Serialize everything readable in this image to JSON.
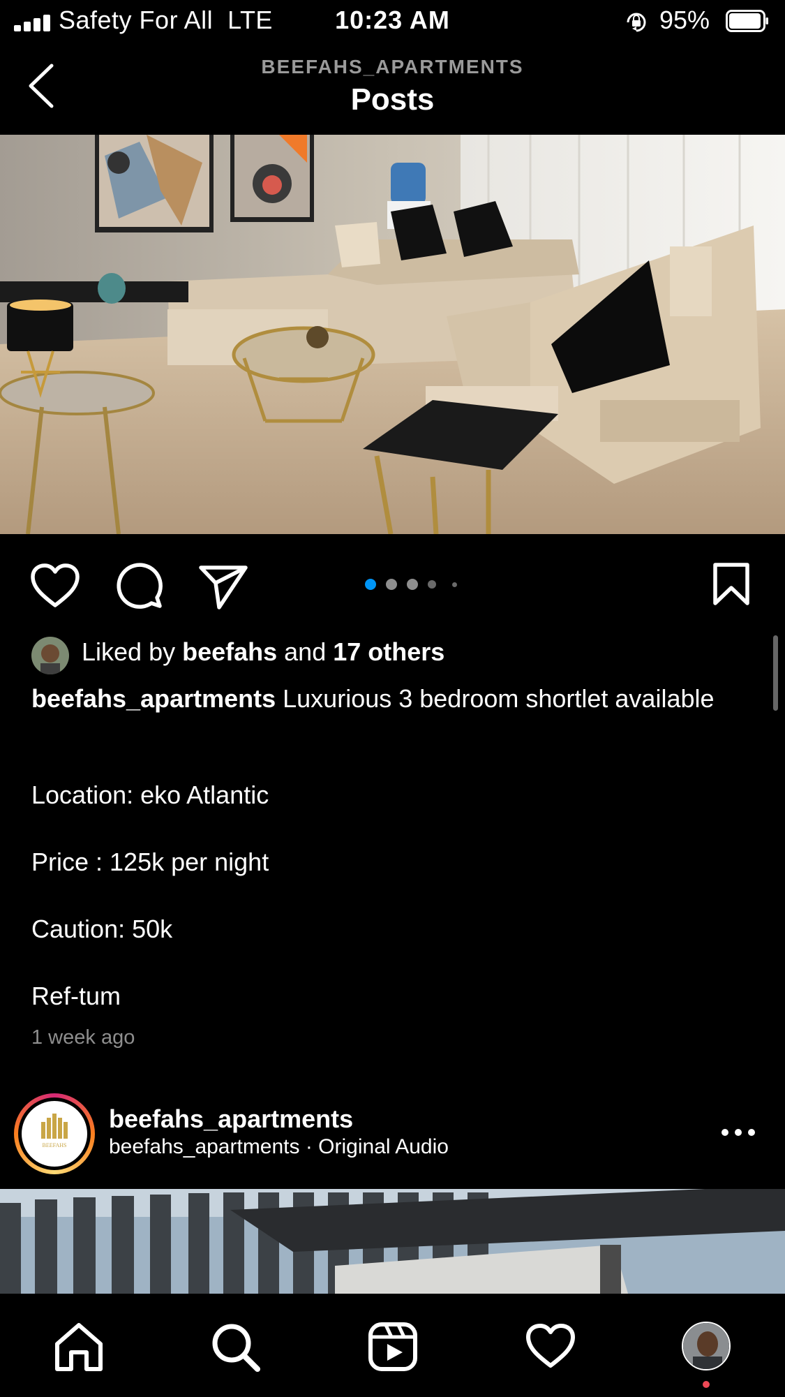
{
  "status_bar": {
    "carrier": "Safety For All  LTE",
    "time": "10:23 AM",
    "battery": "95%"
  },
  "header": {
    "account": "BEEFAHS_APARTMENTS",
    "title": "Posts"
  },
  "post": {
    "carousel_total": 5,
    "carousel_index": 1,
    "liked_by_prefix": "Liked by ",
    "liked_by_user": "beefahs",
    "liked_by_mid": " and ",
    "liked_by_others": "17 others",
    "caption_user": "beefahs_apartments",
    "caption_text": " Luxurious 3 bedroom shortlet available",
    "caption_lines": [
      "Location: eko Atlantic",
      "Price : 125k per night",
      "Caution: 50k",
      "Ref-tum"
    ],
    "time_ago": "1 week ago"
  },
  "next_post": {
    "username": "beefahs_apartments",
    "audio": "beefahs_apartments · Original Audio",
    "logo_text": "BEEFAHS"
  },
  "colors": {
    "accent_blue": "#0095f6",
    "notification_red": "#ed4956",
    "muted_text": "#8e8e8e"
  },
  "icons": [
    "back-icon",
    "heart-icon",
    "comment-icon",
    "share-icon",
    "bookmark-icon",
    "more-icon",
    "home-icon",
    "search-icon",
    "reels-icon",
    "activity-icon"
  ]
}
